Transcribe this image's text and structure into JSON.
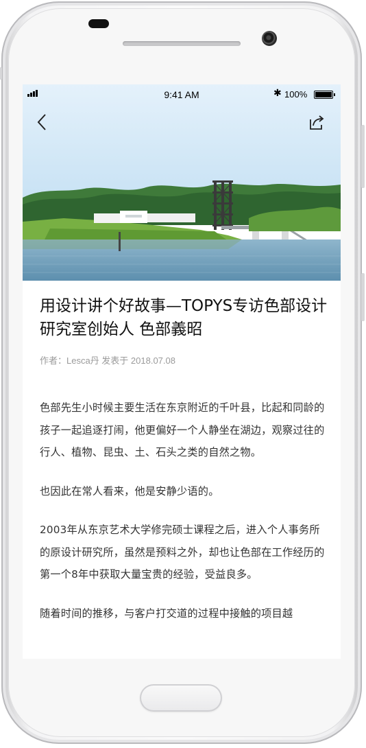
{
  "status_bar": {
    "time": "9:41 AM",
    "battery": "100%",
    "bluetooth_glyph": "✱"
  },
  "navigation": {
    "back_icon": "chevron-left-icon",
    "share_icon": "share-icon"
  },
  "article": {
    "title": "用设计讲个好故事—TOPYS专访色部设计研究室创始人 色部義昭",
    "meta": "作者：Lesca丹  发表于 2018.07.08",
    "paragraphs": [
      "色部先生小时候主要生活在东京附近的千叶县，比起和同龄的孩子一起追逐打闹，他更偏好一个人静坐在湖边，观察过往的行人、植物、昆虫、土、石头之类的自然之物。",
      "也因此在常人看来，他是安静少语的。",
      "2003年从东京艺术大学修完硕士课程之后，进入个人事务所的原设计研究所，虽然是预料之外，却也让色部在工作经历的第一个8年中获取大量宝贵的经验，受益良多。",
      "随着时间的推移，与客户打交道的过程中接触的项目越"
    ]
  },
  "colors": {
    "title": "#111111",
    "meta": "#9a9a9a",
    "body": "#333333",
    "sky": "#cfe7f7",
    "water": "#6fa0bd",
    "grass": "#6da43d"
  }
}
